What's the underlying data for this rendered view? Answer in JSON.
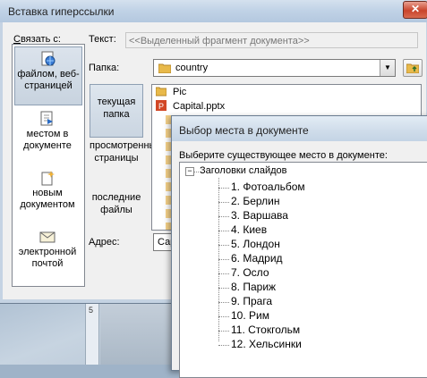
{
  "main_dialog": {
    "title": "Вставка гиперссылки",
    "close_symbol": "✕",
    "link_to_label": "Связать с:",
    "link_to_items": [
      {
        "label": "файлом, веб-страницей",
        "icon": "web-page-icon",
        "selected": true
      },
      {
        "label": "местом в документе",
        "icon": "place-in-document-icon",
        "selected": false
      },
      {
        "label": "новым документом",
        "icon": "new-document-icon",
        "selected": false
      },
      {
        "label": "электронной почтой",
        "icon": "email-icon",
        "selected": false
      }
    ],
    "text_label": "Текст:",
    "text_value": "<<Выделенный фрагмент документа>>",
    "folder_label": "Папка:",
    "folder_value": "country",
    "nav_items": [
      {
        "label": "текущая папка",
        "selected": true
      },
      {
        "label": "просмотренные страницы",
        "selected": false
      },
      {
        "label": "последние файлы",
        "selected": false
      }
    ],
    "files": [
      {
        "name": "Pic",
        "icon": "folder-icon"
      },
      {
        "name": "Capital.pptx",
        "icon": "pptx-file-icon"
      }
    ],
    "address_label": "Адрес:",
    "address_value": "Сар"
  },
  "place_dialog": {
    "title": "Выбор места в документе",
    "prompt": "Выберите существующее место в документе:",
    "root_toggle": "−",
    "root_label": "Заголовки слайдов",
    "slides": [
      "1. Фотоальбом",
      "2. Берлин",
      "3. Варшава",
      "4. Киев",
      "5. Лондон",
      "6. Мадрид",
      "7. Осло",
      "8. Париж",
      "9. Прага",
      "10. Рим",
      "11. Стокгольм",
      "12. Хельсинки"
    ]
  },
  "background": {
    "ruler_mark": "5"
  }
}
